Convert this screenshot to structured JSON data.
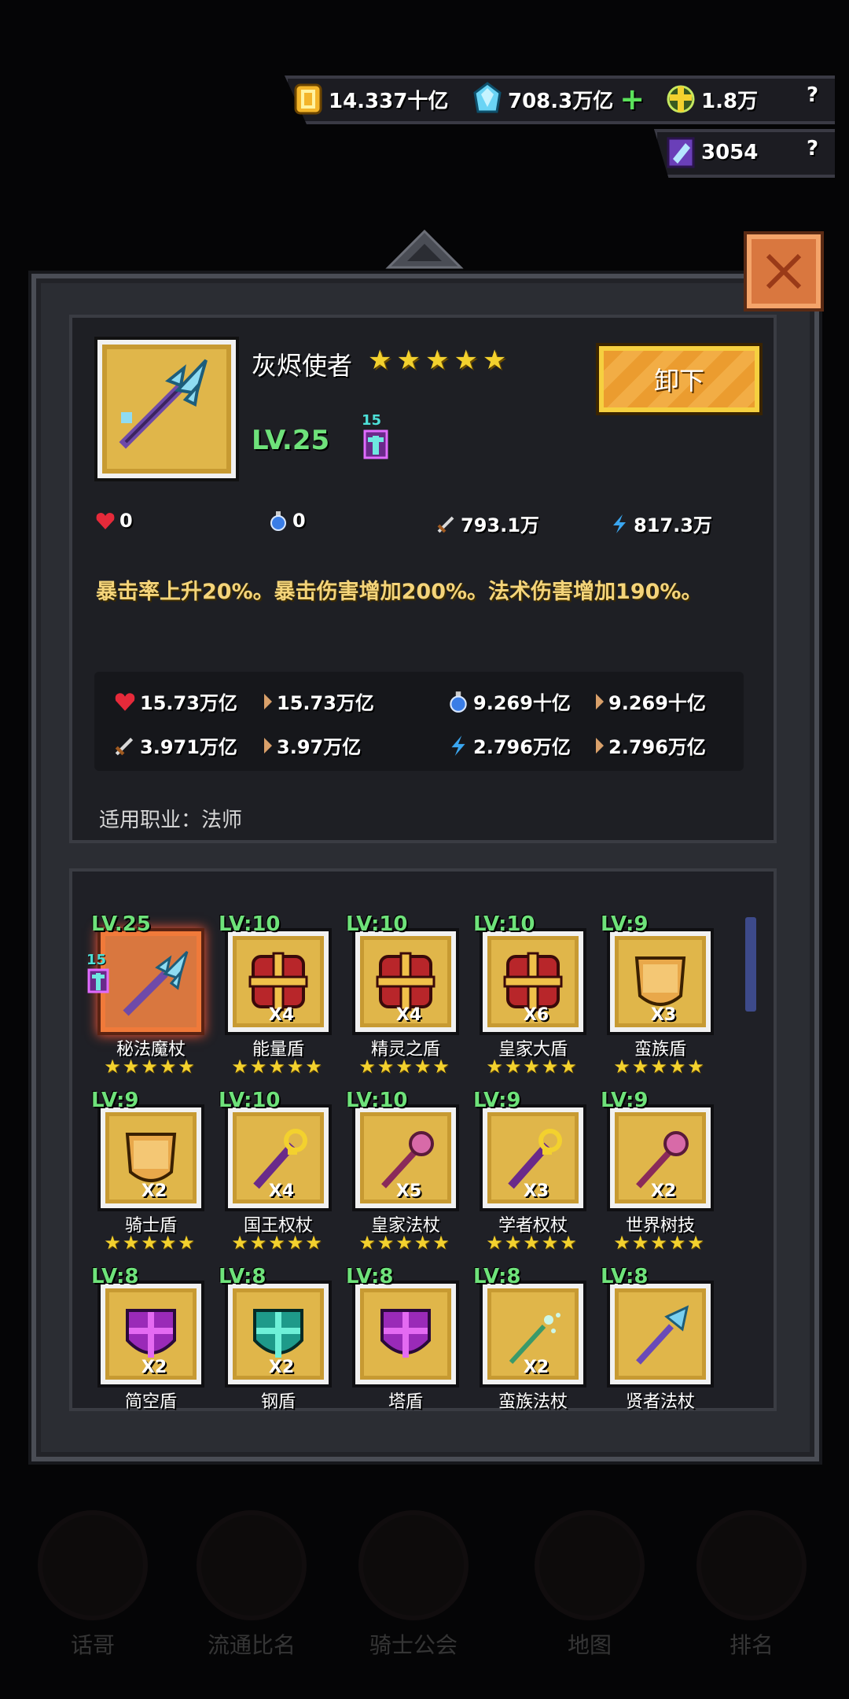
{
  "currencies": {
    "gold": "14.337十亿",
    "diamond": "708.3万亿",
    "diamond_plus": "+",
    "cross": "1.8万",
    "cross_help": "?",
    "crystal": "3054",
    "crystal_help": "?"
  },
  "item": {
    "name": "灰烬使者",
    "stars": "★★★★★",
    "level": "LV.25",
    "rune_count": "15",
    "unequip_label": "卸下",
    "stats": {
      "hp": "0",
      "mana": "0",
      "attack": "793.1万",
      "magic": "817.3万"
    },
    "effect": "暴击率上升20%。暴击伤害增加200%。法术伤害增加190%。",
    "bonus": {
      "hp": "15.73万亿",
      "hp_next": "15.73万亿",
      "mana": "9.269十亿",
      "mana_next": "9.269十亿",
      "attack": "3.971万亿",
      "attack_next": "3.97万亿",
      "magic": "2.796万亿",
      "magic_next": "2.796万亿"
    },
    "job": "适用职业：法师"
  },
  "inventory": [
    {
      "level": "LV.25",
      "name": "秘法魔杖",
      "qty": "",
      "stars": "★★★★★",
      "icon": "trident-staff-icon",
      "selected": true,
      "rune": "15"
    },
    {
      "level": "LV:10",
      "name": "能量盾",
      "qty": "X4",
      "stars": "★★★★★",
      "icon": "cross-shield-icon"
    },
    {
      "level": "LV:10",
      "name": "精灵之盾",
      "qty": "X4",
      "stars": "★★★★★",
      "icon": "cross-shield-icon"
    },
    {
      "level": "LV:10",
      "name": "皇家大盾",
      "qty": "X6",
      "stars": "★★★★★",
      "icon": "cross-shield-icon"
    },
    {
      "level": "LV:9",
      "name": "蛮族盾",
      "qty": "X3",
      "stars": "★★★★★",
      "icon": "round-shield-icon"
    },
    {
      "level": "LV:9",
      "name": "骑士盾",
      "qty": "X2",
      "stars": "★★★★★",
      "icon": "round-shield-icon"
    },
    {
      "level": "LV:10",
      "name": "国王权杖",
      "qty": "X4",
      "stars": "★★★★★",
      "icon": "scepter-icon"
    },
    {
      "level": "LV:10",
      "name": "皇家法杖",
      "qty": "X5",
      "stars": "★★★★★",
      "icon": "pink-staff-icon"
    },
    {
      "level": "LV:9",
      "name": "学者权杖",
      "qty": "X3",
      "stars": "★★★★★",
      "icon": "scepter-icon"
    },
    {
      "level": "LV:9",
      "name": "世界树技",
      "qty": "X2",
      "stars": "★★★★★",
      "icon": "pink-staff-icon"
    },
    {
      "level": "LV:8",
      "name": "简空盾",
      "qty": "X2",
      "stars": "",
      "icon": "purple-shield-icon"
    },
    {
      "level": "LV:8",
      "name": "钢盾",
      "qty": "X2",
      "stars": "",
      "icon": "teal-shield-icon"
    },
    {
      "level": "LV:8",
      "name": "塔盾",
      "qty": "",
      "stars": "",
      "icon": "purple-shield-icon"
    },
    {
      "level": "LV:8",
      "name": "蛮族法杖",
      "qty": "X2",
      "stars": "",
      "icon": "wand-icon"
    },
    {
      "level": "LV:8",
      "name": "贤者法杖",
      "qty": "",
      "stars": "",
      "icon": "axe-staff-icon"
    }
  ],
  "bg_nav": [
    "话哥",
    "流通比名",
    "骑士公会",
    "地图",
    "排名"
  ]
}
